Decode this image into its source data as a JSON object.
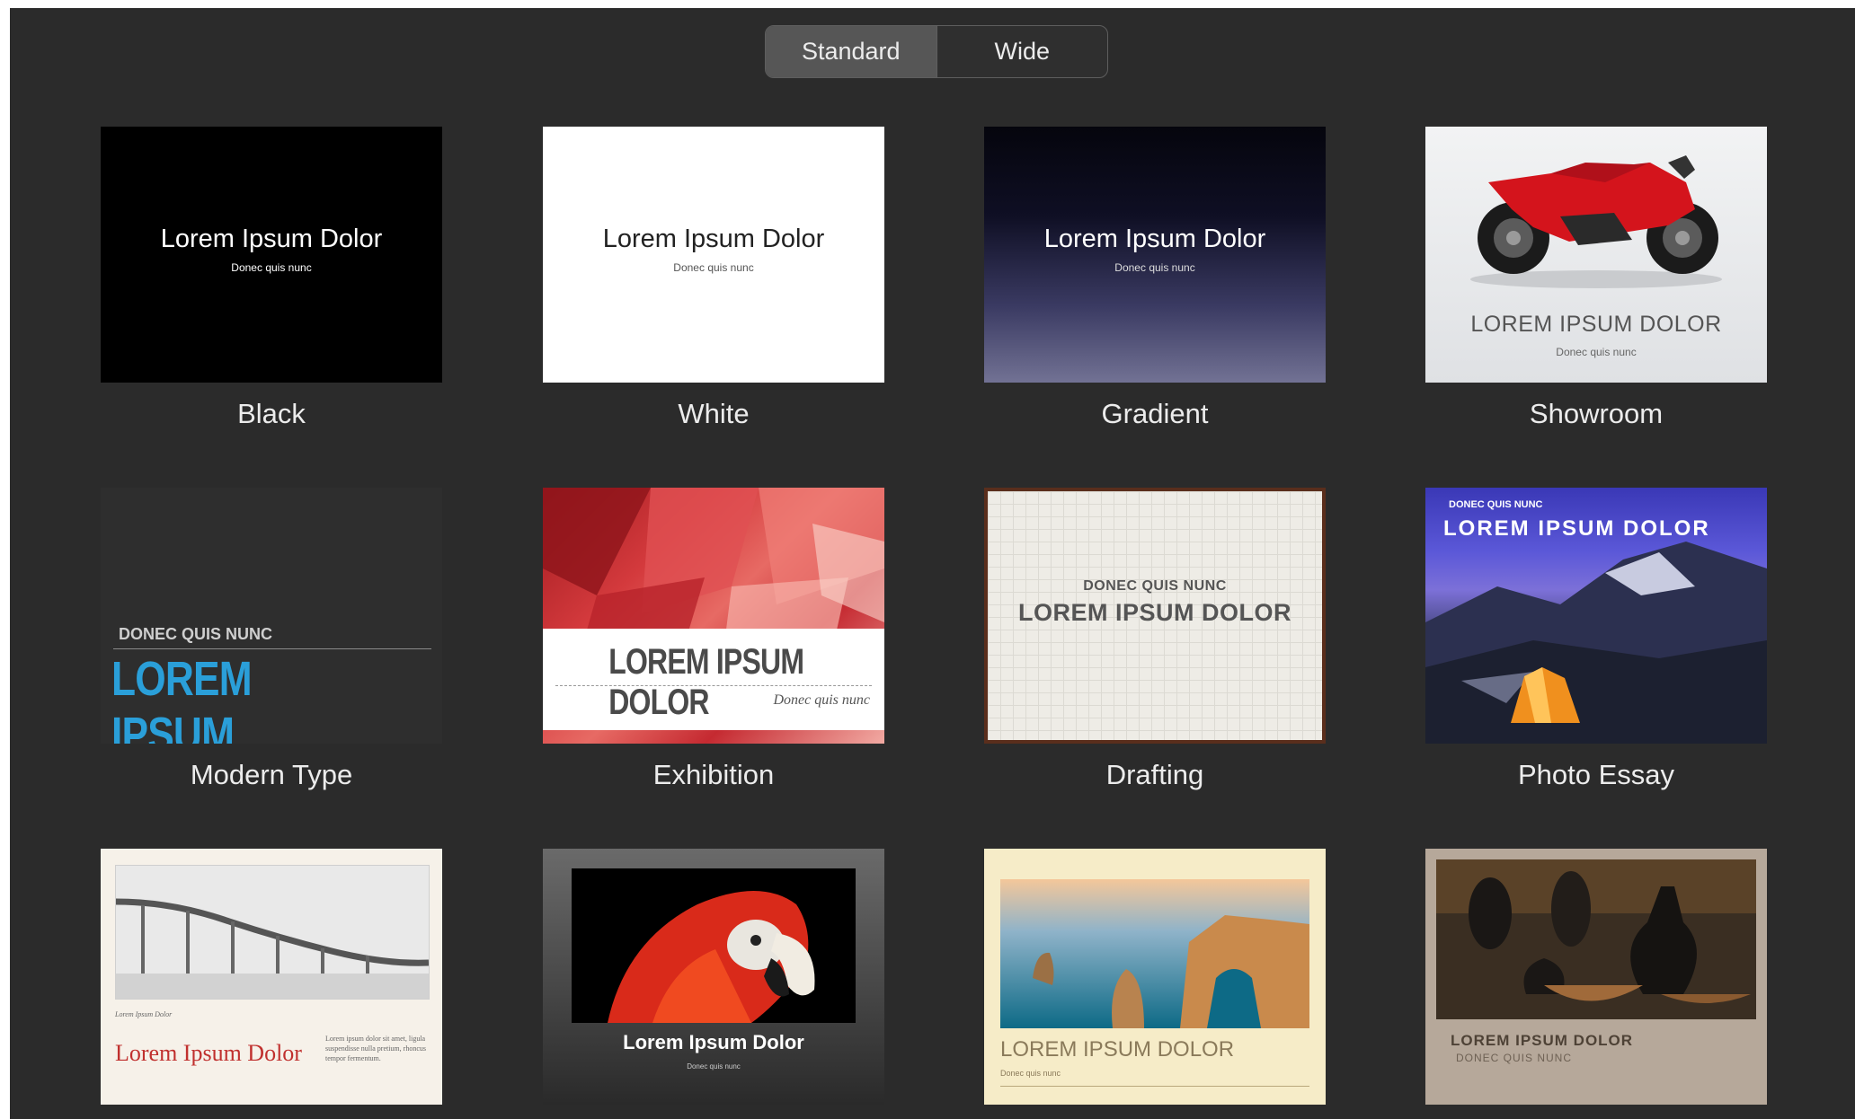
{
  "segment": {
    "options": [
      "Standard",
      "Wide"
    ],
    "selected": "Standard"
  },
  "themes": [
    {
      "name": "Black",
      "title": "Lorem Ipsum Dolor",
      "subtitle": "Donec quis nunc"
    },
    {
      "name": "White",
      "title": "Lorem Ipsum Dolor",
      "subtitle": "Donec quis nunc"
    },
    {
      "name": "Gradient",
      "title": "Lorem Ipsum Dolor",
      "subtitle": "Donec quis nunc"
    },
    {
      "name": "Showroom",
      "title": "LOREM IPSUM DOLOR",
      "subtitle": "Donec quis nunc"
    },
    {
      "name": "Modern Type",
      "kicker": "DONEC QUIS NUNC",
      "title": "LOREM IPSUM"
    },
    {
      "name": "Exhibition",
      "title": "LOREM IPSUM DOLOR",
      "subtitle": "Donec quis nunc"
    },
    {
      "name": "Drafting",
      "kicker": "DONEC QUIS NUNC",
      "title": "LOREM IPSUM DOLOR"
    },
    {
      "name": "Photo Essay",
      "kicker": "DONEC QUIS NUNC",
      "title": "LOREM IPSUM DOLOR"
    },
    {
      "name": "",
      "caption": "Lorem Ipsum Dolor",
      "title": "Lorem Ipsum Dolor",
      "body": "Lorem ipsum dolor sit amet, ligula suspendisse nulla pretium, rhoncus tempor fermentum."
    },
    {
      "name": "",
      "title": "Lorem Ipsum Dolor",
      "subtitle": "Donec quis nunc"
    },
    {
      "name": "",
      "title": "LOREM IPSUM DOLOR",
      "subtitle": "Donec quis nunc"
    },
    {
      "name": "",
      "title": "LOREM IPSUM DOLOR",
      "subtitle": "DONEC QUIS NUNC"
    }
  ]
}
